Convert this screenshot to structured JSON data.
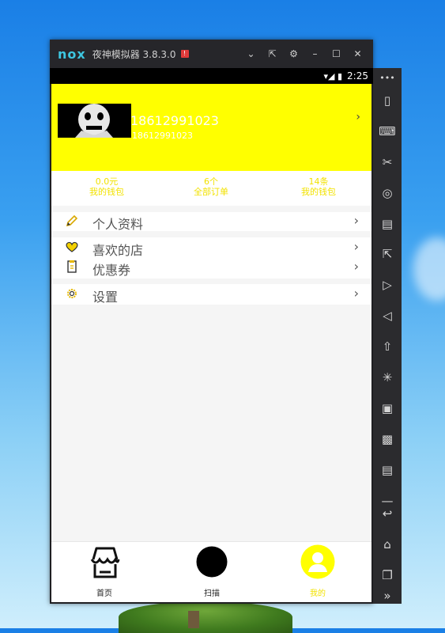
{
  "window": {
    "logo": "nox",
    "title": "夜神模拟器 3.8.3.0",
    "badge": "!",
    "controls": [
      "⌄",
      "⇱",
      "⚙",
      "–",
      "☐",
      "✕"
    ]
  },
  "statusbar": {
    "icons": "▾◢ ▮",
    "time": "2:25"
  },
  "profile": {
    "username": "18612991023",
    "userid": "18612991023",
    "bg_color": "#ffff00"
  },
  "stats": [
    {
      "value": "0.0元",
      "label": "我的钱包"
    },
    {
      "value": "6个",
      "label": "全部订单"
    },
    {
      "value": "14条",
      "label": "我的钱包"
    }
  ],
  "menu": [
    {
      "icon": "pencil-icon",
      "label": "个人资料"
    },
    {
      "icon": "heart-icon",
      "label": "喜欢的店"
    },
    {
      "icon": "coupon-icon",
      "label": "优惠券"
    },
    {
      "icon": "gear-icon",
      "label": "设置"
    }
  ],
  "tabs": [
    {
      "label": "首页",
      "icon": "store-icon"
    },
    {
      "label": "扫描",
      "icon": "scan-icon"
    },
    {
      "label": "我的",
      "icon": "user-icon"
    }
  ],
  "accent_color": "#f2e200",
  "sidebar": {
    "more": "•••",
    "items": [
      "phone-rotate-icon",
      "keyboard-icon",
      "scissors-icon",
      "location-icon",
      "screen-icon",
      "fullscreen-icon",
      "volume-up-icon",
      "volume-down-icon",
      "apk-install-icon",
      "shake-icon",
      "mouse-icon",
      "video-record-icon",
      "multi-instance-icon",
      "menu-icon",
      "back-icon",
      "home-icon",
      "recent-apps-icon",
      "expand-icon"
    ]
  }
}
